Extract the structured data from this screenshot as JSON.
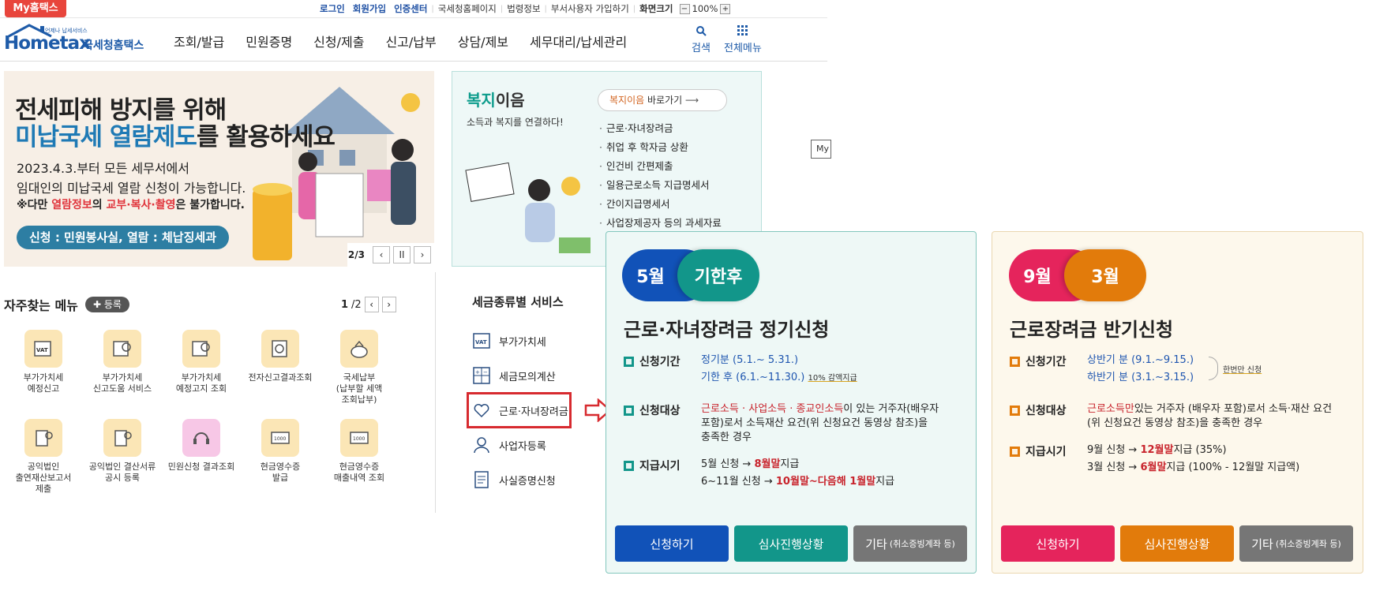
{
  "top": {
    "my_hometax": "My홈택스",
    "links": [
      "로그인",
      "회원가입",
      "인증센터",
      "국세청홈페이지",
      "법령정보",
      "부서사용자 가입하기"
    ],
    "screen_size_label": "화면크기",
    "zoom_minus": "−",
    "zoom_value": "100%",
    "zoom_plus": "+"
  },
  "header": {
    "logo_tiny": "언제나 납세서비스",
    "logo_main": "Hometax",
    "logo_sub": "국세청홈택스",
    "nav": [
      "조회/발급",
      "민원증명",
      "신청/제출",
      "신고/납부",
      "상담/제보",
      "세무대리/납세관리"
    ],
    "search_label": "검색",
    "all_menu_label": "전체메뉴"
  },
  "banner": {
    "line1": "전세피해 방지를 위해",
    "line2_a": "미납국세 열람제도",
    "line2_b": "를 활용하세요",
    "desc1": "2023.4.3.부터 모든 세무서에서",
    "desc2": "임대인의 미납국세 열람 신청이 가능합니다.",
    "desc3_a": "※다만 ",
    "desc3_b": "열람정보",
    "desc3_c": "의 ",
    "desc3_d": "교부·복사·촬영",
    "desc3_e": "은 불가합니다.",
    "pill": "신청 : 민원봉사실, 열람 : 체납징세과",
    "page_current": "2",
    "page_sep": "/",
    "page_total": "3",
    "prev": "‹",
    "pause": "II",
    "next": "›"
  },
  "welfare": {
    "title_a": "복지",
    "title_b": "이음",
    "sub": "소득과 복지를 연결하다!",
    "btn_a": "복지이음",
    "btn_b": " 바로가기",
    "items": [
      "근로·자녀장려금",
      "취업 후 학자금 상환",
      "인건비 간편제출",
      "일용근로소득 지급명세서",
      "간이지급명세서",
      "사업장제공자 등의 과세자료"
    ]
  },
  "mybox": "My",
  "favorites": {
    "title": "자주찾는 메뉴",
    "register": "✚ 등록",
    "page_current": "1",
    "page_total": "/2",
    "prev": "‹",
    "next": "›",
    "items": [
      "부가가치세\n예정신고",
      "부가가치세\n신고도움 서비스",
      "부가가치세\n예정고지 조회",
      "전자신고결과조회",
      "국세납부\n(납부할 세액\n조회납부)",
      "공익법인\n출연재산보고서\n제출",
      "공익법인 결산서류\n공시 등록",
      "민원신청 결과조회",
      "현금영수증\n발급",
      "현금영수증\n매출내역 조회"
    ]
  },
  "tax_service": {
    "title": "세금종류별 서비스",
    "items": [
      "부가가치세",
      "세금모의계산",
      "근로·자녀장려금",
      "사업자등록",
      "사실증명신청"
    ]
  },
  "card1": {
    "pill_a": "5월",
    "pill_b": "기한후",
    "title": "근로·자녀장려금 정기신청",
    "period_label": "신청기간",
    "period_1": "정기분 (5.1.~ 5.31.)",
    "period_2": "기한 후 (6.1.~11.30.)",
    "period_2_note": "10% 감액지급",
    "target_label": "신청대상",
    "target_1a": "근로소득 · 사업소득 · 종교인소득",
    "target_1b": "이 있는 거주자(배우자",
    "target_2": "포함)로서 소득재산 요건(위 신청요건 동영상 참조)을",
    "target_3": "충족한 경우",
    "pay_label": "지급시기",
    "pay_1a": "5월 신청 → ",
    "pay_1b": "8월말",
    "pay_1c": "지급",
    "pay_2a": "6~11월 신청 → ",
    "pay_2b": "10월말~다음해 1월말",
    "pay_2c": "지급",
    "btn_apply": "신청하기",
    "btn_status": "심사진행상황",
    "btn_etc": "기타",
    "btn_etc_small": "(취소증빙계좌 등)"
  },
  "card2": {
    "pill_a": "9월",
    "pill_b": "3월",
    "title": "근로장려금 반기신청",
    "period_label": "신청기간",
    "period_1": "상반기 분 (9.1.~9.15.)",
    "period_2": "하반기 분 (3.1.~3.15.)",
    "period_note": "한번만 신청",
    "target_label": "신청대상",
    "target_1a": "근로소득만",
    "target_1b": "있는 거주자 (배우자 포함)로서 소득·재산 요건",
    "target_2": "(위 신청요건 동영상 참조)을 충족한 경우",
    "pay_label": "지급시기",
    "pay_1a": "9월 신청 → ",
    "pay_1b": "12월말",
    "pay_1c": "지급 (35%)",
    "pay_2a": "3월 신청 → ",
    "pay_2b": "6월말",
    "pay_2c": "지급 (100% - 12월말 지급액)",
    "btn_apply": "신청하기",
    "btn_status": "심사진행상황",
    "btn_etc": "기타",
    "btn_etc_small": "(취소증빙계좌 등)"
  },
  "colors": {
    "brand_blue": "#1e5ba8",
    "accent_red": "#e8453c",
    "card1_blue": "#1152b8",
    "card1_teal": "#12968a",
    "card2_pink": "#e5245c",
    "card2_orange": "#e27b0b",
    "gray_btn": "#767676"
  }
}
